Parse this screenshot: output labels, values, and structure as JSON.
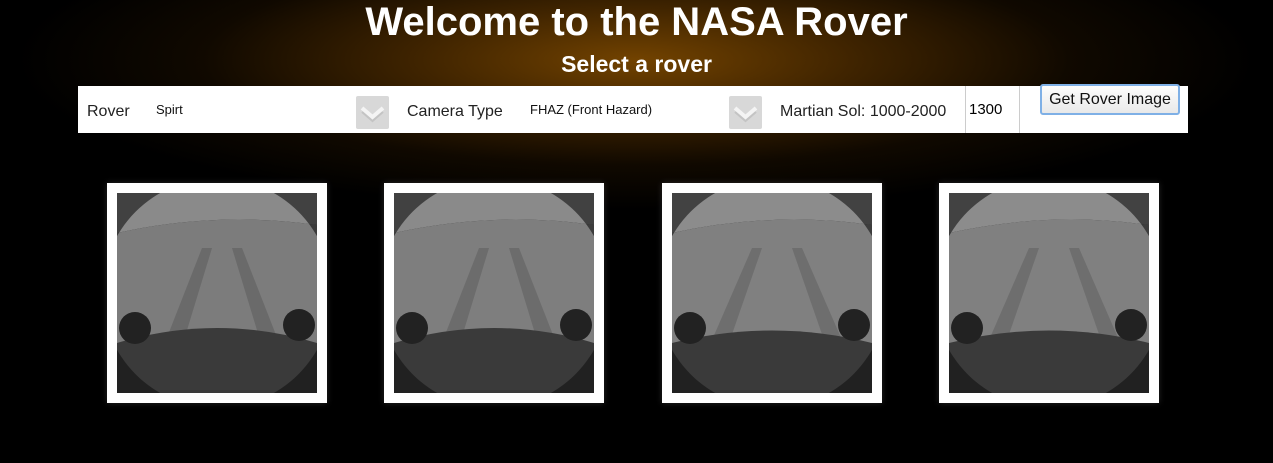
{
  "header": {
    "title": "Welcome to the NASA Rover",
    "subtitle": "Select a rover"
  },
  "controls": {
    "rover_label": "Rover",
    "rover_value": "Spirt",
    "camera_label": "Camera Type",
    "camera_value": "FHAZ (Front Hazard)",
    "sol_label": "Martian Sol: 1000-2000",
    "sol_value": "1300",
    "submit_label": "Get Rover Image"
  },
  "icons": {
    "dropdown": "chevron-down-icon"
  },
  "gallery": {
    "photo_count": 4
  }
}
